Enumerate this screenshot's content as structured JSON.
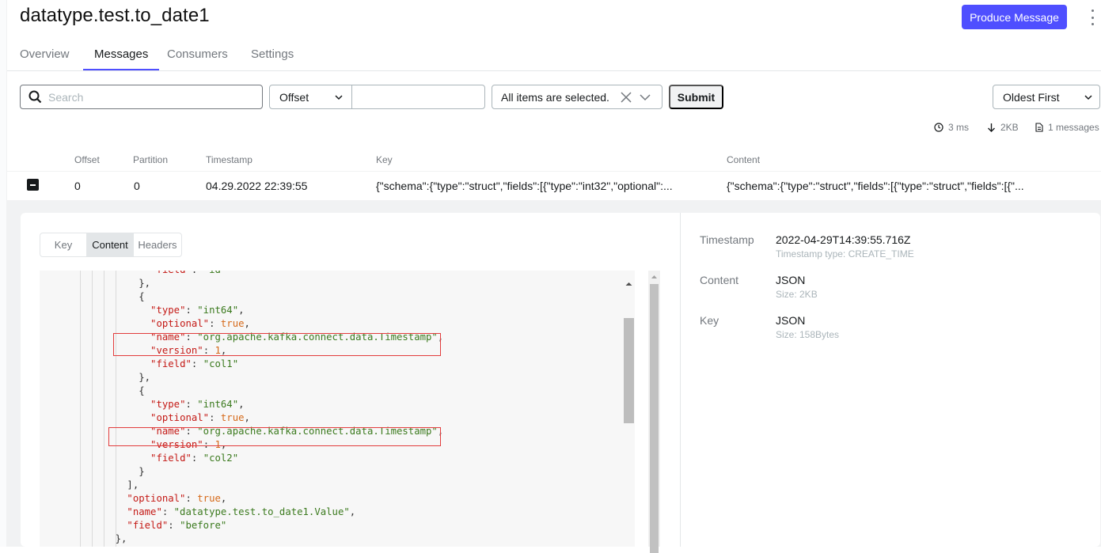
{
  "topic_title": "datatype.test.to_date1",
  "produce_button": "Produce Message",
  "tabs": [
    {
      "label": "Overview"
    },
    {
      "label": "Messages"
    },
    {
      "label": "Consumers"
    },
    {
      "label": "Settings"
    }
  ],
  "filters": {
    "search_placeholder": "Search",
    "seek_type": "Offset",
    "offset_value": "",
    "partitions": "All items are selected.",
    "submit": "Submit",
    "sort": "Oldest First"
  },
  "stats": {
    "time": "3 ms",
    "bytes": "2KB",
    "messages": "1 messages"
  },
  "table": {
    "headers": [
      "Offset",
      "Partition",
      "Timestamp",
      "Key",
      "Content"
    ],
    "row": {
      "offset": "0",
      "partition": "0",
      "timestamp": "04.29.2022 22:39:55",
      "key": "{\"schema\":{\"type\":\"struct\",\"fields\":[{\"type\":\"int32\",\"optional\":...",
      "content": "{\"schema\":{\"type\":\"struct\",\"fields\":[{\"type\":\"struct\",\"fields\":[{\"..."
    }
  },
  "detail_tabs": [
    {
      "label": "Key"
    },
    {
      "label": "Content"
    },
    {
      "label": "Headers"
    }
  ],
  "code_lines": [
    "          \"field\": \"id\"",
    "        },",
    "        {",
    "          \"type\": \"int64\",",
    "          \"optional\": true,",
    "          \"name\": \"org.apache.kafka.connect.data.Timestamp\",",
    "          \"version\": 1,",
    "          \"field\": \"col1\"",
    "        },",
    "        {",
    "          \"type\": \"int64\",",
    "          \"optional\": true,",
    "          \"name\": \"org.apache.kafka.connect.data.Timestamp\",",
    "          \"version\": 1,",
    "          \"field\": \"col2\"",
    "        }",
    "      ],",
    "      \"optional\": true,",
    "      \"name\": \"datatype.test.to_date1.Value\",",
    "      \"field\": \"before\"",
    "    },"
  ],
  "meta": {
    "timestamp_label": "Timestamp",
    "timestamp_value": "2022-04-29T14:39:55.716Z",
    "timestamp_type": "Timestamp type: CREATE_TIME",
    "content_label": "Content",
    "content_value": "JSON",
    "content_size": "Size: 2KB",
    "key_label": "Key",
    "key_value": "JSON",
    "key_size": "Size: 158Bytes"
  },
  "colors": {
    "accent": "#4f4fff",
    "json_key": "#c41a16",
    "json_string": "#3b7a1e",
    "json_literal": "#d66a1a",
    "highlight_box": "#e23c3c"
  }
}
